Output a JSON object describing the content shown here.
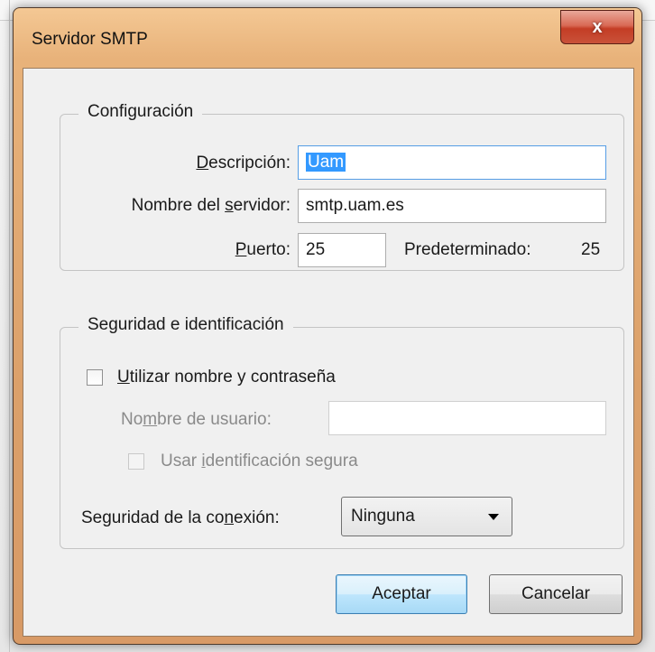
{
  "window": {
    "title": "Servidor SMTP",
    "close_label": "x"
  },
  "configuracion": {
    "legend": "Configuración",
    "descripcion": {
      "pre": "",
      "ul": "D",
      "post": "escripción:",
      "value": "Uam"
    },
    "servidor": {
      "pre": "Nombre del ",
      "ul": "s",
      "post": "ervidor:",
      "value": "smtp.uam.es"
    },
    "puerto": {
      "pre": "",
      "ul": "P",
      "post": "uerto:",
      "value": "25"
    },
    "predeterminado_label": "Predeterminado:",
    "predeterminado_value": "25"
  },
  "seguridad": {
    "legend": "Seguridad e identificación",
    "usar_password": {
      "pre": "",
      "ul": "U",
      "post": "tilizar nombre y contraseña",
      "checked": false
    },
    "usuario": {
      "pre": "No",
      "ul": "m",
      "post": "bre de usuario:",
      "value": ""
    },
    "ident_segura": {
      "pre": "Usar ",
      "ul": "i",
      "post": "dentificación segura",
      "checked": false
    },
    "conexion": {
      "pre": "Seguridad de la co",
      "ul": "n",
      "post": "exión:",
      "value": "Ninguna"
    }
  },
  "buttons": {
    "aceptar": "Aceptar",
    "cancelar": "Cancelar"
  }
}
